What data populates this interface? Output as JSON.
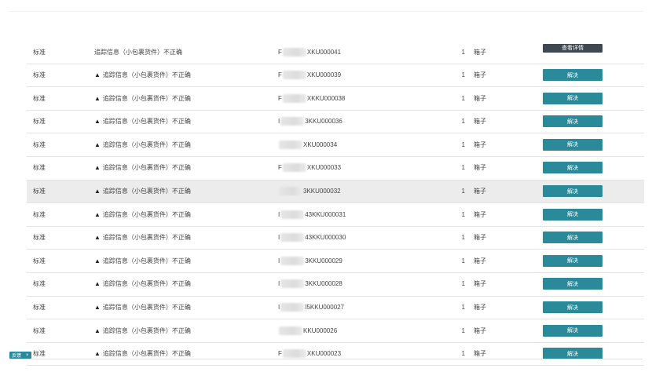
{
  "rows": [
    {
      "type": "标准",
      "desc": "追踪信息（小包裹货件）不正确",
      "warn": false,
      "prefix": "F",
      "suffix": "XKU000041",
      "qty": "1",
      "unit": "箱子",
      "action": "查看详情",
      "style": "dark",
      "highlight": false
    },
    {
      "type": "标准",
      "desc": "追踪信息（小包裹货件）不正确",
      "warn": true,
      "prefix": "F",
      "suffix": "XKU000039",
      "qty": "1",
      "unit": "箱子",
      "action": "解决",
      "style": "teal",
      "highlight": false
    },
    {
      "type": "标准",
      "desc": "追踪信息（小包裹货件）不正确",
      "warn": true,
      "prefix": "F",
      "suffix": "XKKU000038",
      "qty": "1",
      "unit": "箱子",
      "action": "解决",
      "style": "teal",
      "highlight": false
    },
    {
      "type": "标准",
      "desc": "追踪信息（小包裹货件）不正确",
      "warn": true,
      "prefix": "I",
      "suffix": "3KKU000036",
      "qty": "1",
      "unit": "箱子",
      "action": "解决",
      "style": "teal",
      "highlight": false
    },
    {
      "type": "标准",
      "desc": "追踪信息（小包裹货件）不正确",
      "warn": true,
      "prefix": "",
      "suffix": "XKU000034",
      "qty": "1",
      "unit": "箱子",
      "action": "解决",
      "style": "teal",
      "highlight": false
    },
    {
      "type": "标准",
      "desc": "追踪信息（小包裹货件）不正确",
      "warn": true,
      "prefix": "F",
      "suffix": "XKU000033",
      "qty": "1",
      "unit": "箱子",
      "action": "解决",
      "style": "teal",
      "highlight": false
    },
    {
      "type": "标准",
      "desc": "追踪信息（小包裹货件）不正确",
      "warn": true,
      "prefix": "",
      "suffix": "3KKU000032",
      "qty": "1",
      "unit": "箱子",
      "action": "解决",
      "style": "teal",
      "highlight": true
    },
    {
      "type": "标准",
      "desc": "追踪信息（小包裹货件）不正确",
      "warn": true,
      "prefix": "I",
      "suffix": "43KKU000031",
      "qty": "1",
      "unit": "箱子",
      "action": "解决",
      "style": "teal",
      "highlight": false
    },
    {
      "type": "标准",
      "desc": "追踪信息（小包裹货件）不正确",
      "warn": true,
      "prefix": "I",
      "suffix": "43KKU000030",
      "qty": "1",
      "unit": "箱子",
      "action": "解决",
      "style": "teal",
      "highlight": false
    },
    {
      "type": "标准",
      "desc": "追踪信息（小包裹货件）不正确",
      "warn": true,
      "prefix": "I",
      "suffix": "3KKU000029",
      "qty": "1",
      "unit": "箱子",
      "action": "解决",
      "style": "teal",
      "highlight": false
    },
    {
      "type": "标准",
      "desc": "追踪信息（小包裹货件）不正确",
      "warn": true,
      "prefix": "I",
      "suffix": "3KKU000028",
      "qty": "1",
      "unit": "箱子",
      "action": "解决",
      "style": "teal",
      "highlight": false
    },
    {
      "type": "标准",
      "desc": "追踪信息（小包裹货件）不正确",
      "warn": true,
      "prefix": "I",
      "suffix": "I5KKU000027",
      "qty": "1",
      "unit": "箱子",
      "action": "解决",
      "style": "teal",
      "highlight": false
    },
    {
      "type": "标准",
      "desc": "追踪信息（小包裹货件）不正确",
      "warn": true,
      "prefix": "",
      "suffix": "KKU000026",
      "qty": "1",
      "unit": "箱子",
      "action": "解决",
      "style": "teal",
      "highlight": false
    },
    {
      "type": "标准",
      "desc": "追踪信息（小包裹货件）不正确",
      "warn": true,
      "prefix": "F",
      "suffix": "XKU000023",
      "qty": "1",
      "unit": "箱子",
      "action": "解决",
      "style": "teal",
      "highlight": false
    }
  ],
  "bottom_tag": {
    "label": "反馈",
    "close": "×"
  },
  "colors": {
    "teal": "#2b8a9a",
    "dark": "#3f4750",
    "highlight": "#ececec"
  },
  "icons": {
    "warning": "warning-triangle-icon"
  }
}
